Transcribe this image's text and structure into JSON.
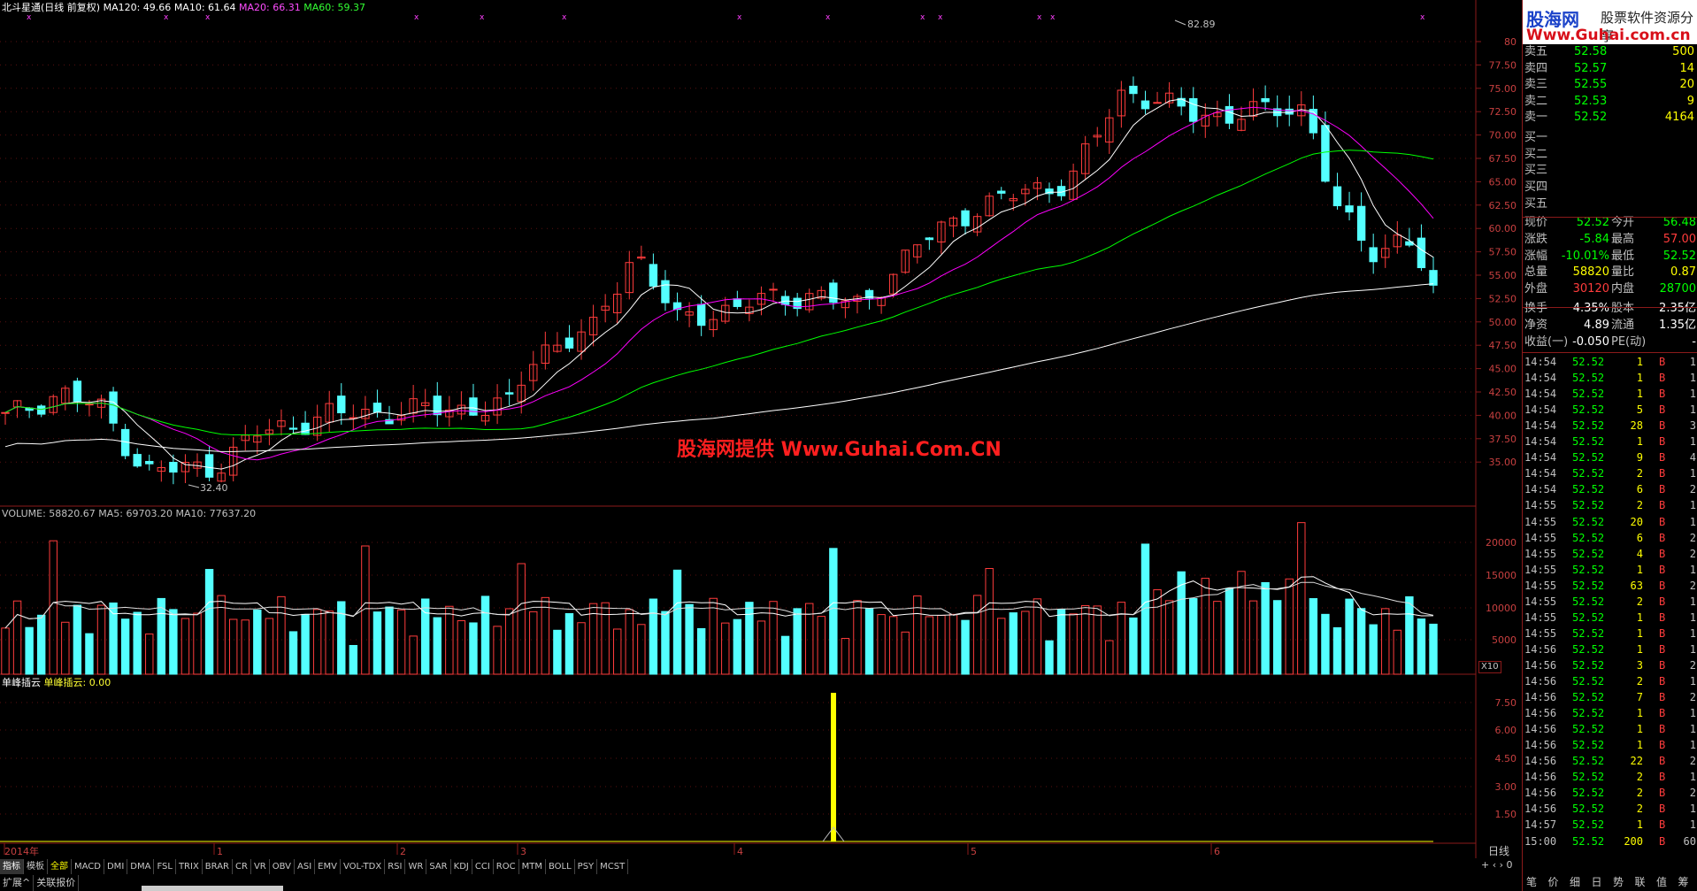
{
  "header": {
    "main_title": "北斗星通(日线 前复权)",
    "ma120": "MA120: 49.66",
    "ma10": "MA10: 61.64",
    "ma20": "MA20: 66.31",
    "ma60": "MA60: 59.37"
  },
  "price_annotations": {
    "high_label": "82.89",
    "low_label": "32.40"
  },
  "watermark": "股海网提供 Www.Guhai.Com.CN",
  "volume_header": {
    "volume": "VOLUME: 58820.67",
    "ma5": "MA5: 69703.20",
    "ma10": "MA10: 77637.20"
  },
  "indicator_header": {
    "name": "单峰插云",
    "value": "单峰插云: 0.00"
  },
  "price_axis_ticks": [
    "80",
    "77.50",
    "75.00",
    "72.50",
    "70.00",
    "67.50",
    "65.00",
    "62.50",
    "60.00",
    "57.50",
    "55.00",
    "52.50",
    "50.00",
    "47.50",
    "45.00",
    "42.50",
    "40.00",
    "37.50",
    "35.00"
  ],
  "volume_axis_ticks": [
    "20000",
    "15000",
    "10000",
    "5000"
  ],
  "volume_unit": "X10",
  "indicator_axis_ticks": [
    "7.50",
    "6.00",
    "4.50",
    "3.00",
    "1.50"
  ],
  "date_axis": [
    "2014年",
    "1",
    "2",
    "3",
    "4",
    "5",
    "6"
  ],
  "period_label": "日线",
  "tabs": [
    "指标",
    "模板",
    "全部",
    "MACD",
    "DMI",
    "DMA",
    "FSL",
    "TRIX",
    "BRAR",
    "CR",
    "VR",
    "OBV",
    "ASI",
    "EMV",
    "VOL-TDX",
    "RSI",
    "WR",
    "SAR",
    "KDJ",
    "CCI",
    "ROC",
    "MTM",
    "BOLL",
    "PSY",
    "MCST"
  ],
  "bottom_tabs": [
    "扩展^",
    "关联报价"
  ],
  "right_bottom_tabs": [
    "笔",
    "价",
    "细",
    "日",
    "势",
    "联",
    "值",
    "筹"
  ],
  "logo": {
    "l1": "股海网",
    "l2": "股票软件资源分享",
    "l3": "Www.Guhai.com.cn"
  },
  "asks": [
    {
      "label": "卖五",
      "price": "52.58",
      "vol": "500"
    },
    {
      "label": "卖四",
      "price": "52.57",
      "vol": "14"
    },
    {
      "label": "卖三",
      "price": "52.55",
      "vol": "20"
    },
    {
      "label": "卖二",
      "price": "52.53",
      "vol": "9"
    },
    {
      "label": "卖一",
      "price": "52.52",
      "vol": "4164"
    }
  ],
  "bids": [
    "买一",
    "买二",
    "买三",
    "买四",
    "买五"
  ],
  "quote_stats": [
    {
      "l1": "现价",
      "v1": "52.52",
      "l2": "今开",
      "v2": "56.48"
    },
    {
      "l1": "涨跌",
      "v1": "-5.84",
      "l2": "最高",
      "v2": "57.00"
    },
    {
      "l1": "涨幅",
      "v1": "-10.01%",
      "l2": "最低",
      "v2": "52.52"
    },
    {
      "l1": "总量",
      "v1": "58820",
      "l2": "量比",
      "v2": "0.87"
    },
    {
      "l1": "外盘",
      "v1": "30120",
      "l2": "内盘",
      "v2": "28700"
    },
    {
      "l1": "换手",
      "v1": "4.35%",
      "l2": "股本",
      "v2": "2.35亿"
    },
    {
      "l1": "净资",
      "v1": "4.89",
      "l2": "流通",
      "v2": "1.35亿"
    },
    {
      "l1": "收益(一)",
      "v1": "-0.050",
      "l2": "PE(动)",
      "v2": "-"
    }
  ],
  "ticks": [
    {
      "t": "14:54",
      "p": "52.52",
      "v": "1",
      "s": "B",
      "n": "1"
    },
    {
      "t": "14:54",
      "p": "52.52",
      "v": "1",
      "s": "B",
      "n": "1"
    },
    {
      "t": "14:54",
      "p": "52.52",
      "v": "1",
      "s": "B",
      "n": "1"
    },
    {
      "t": "14:54",
      "p": "52.52",
      "v": "5",
      "s": "B",
      "n": "1"
    },
    {
      "t": "14:54",
      "p": "52.52",
      "v": "28",
      "s": "B",
      "n": "3"
    },
    {
      "t": "14:54",
      "p": "52.52",
      "v": "1",
      "s": "B",
      "n": "1"
    },
    {
      "t": "14:54",
      "p": "52.52",
      "v": "9",
      "s": "B",
      "n": "4"
    },
    {
      "t": "14:54",
      "p": "52.52",
      "v": "2",
      "s": "B",
      "n": "1"
    },
    {
      "t": "14:54",
      "p": "52.52",
      "v": "6",
      "s": "B",
      "n": "2"
    },
    {
      "t": "14:55",
      "p": "52.52",
      "v": "2",
      "s": "B",
      "n": "1"
    },
    {
      "t": "14:55",
      "p": "52.52",
      "v": "20",
      "s": "B",
      "n": "1"
    },
    {
      "t": "14:55",
      "p": "52.52",
      "v": "6",
      "s": "B",
      "n": "2"
    },
    {
      "t": "14:55",
      "p": "52.52",
      "v": "4",
      "s": "B",
      "n": "2"
    },
    {
      "t": "14:55",
      "p": "52.52",
      "v": "1",
      "s": "B",
      "n": "1"
    },
    {
      "t": "14:55",
      "p": "52.52",
      "v": "63",
      "s": "B",
      "n": "2"
    },
    {
      "t": "14:55",
      "p": "52.52",
      "v": "2",
      "s": "B",
      "n": "1"
    },
    {
      "t": "14:55",
      "p": "52.52",
      "v": "1",
      "s": "B",
      "n": "1"
    },
    {
      "t": "14:55",
      "p": "52.52",
      "v": "1",
      "s": "B",
      "n": "1"
    },
    {
      "t": "14:56",
      "p": "52.52",
      "v": "1",
      "s": "B",
      "n": "1"
    },
    {
      "t": "14:56",
      "p": "52.52",
      "v": "3",
      "s": "B",
      "n": "2"
    },
    {
      "t": "14:56",
      "p": "52.52",
      "v": "2",
      "s": "B",
      "n": "1"
    },
    {
      "t": "14:56",
      "p": "52.52",
      "v": "7",
      "s": "B",
      "n": "2"
    },
    {
      "t": "14:56",
      "p": "52.52",
      "v": "1",
      "s": "B",
      "n": "1"
    },
    {
      "t": "14:56",
      "p": "52.52",
      "v": "1",
      "s": "B",
      "n": "1"
    },
    {
      "t": "14:56",
      "p": "52.52",
      "v": "1",
      "s": "B",
      "n": "1"
    },
    {
      "t": "14:56",
      "p": "52.52",
      "v": "22",
      "s": "B",
      "n": "2"
    },
    {
      "t": "14:56",
      "p": "52.52",
      "v": "2",
      "s": "B",
      "n": "1"
    },
    {
      "t": "14:56",
      "p": "52.52",
      "v": "2",
      "s": "B",
      "n": "2"
    },
    {
      "t": "14:56",
      "p": "52.52",
      "v": "2",
      "s": "B",
      "n": "1"
    },
    {
      "t": "14:57",
      "p": "52.52",
      "v": "1",
      "s": "B",
      "n": "1"
    },
    {
      "t": "15:00",
      "p": "52.52",
      "v": "200",
      "s": "B",
      "n": "60"
    }
  ],
  "colors": {
    "up": "#ff3c3c",
    "down": "#54ffff",
    "ma10": "#ffffff",
    "ma20": "#ff00ff",
    "ma60": "#00ff00",
    "ma120": "#ffffff",
    "grid": "#8b1a1a",
    "indicator": "#ffff00",
    "price_green": "#00ff00",
    "price_yellow": "#ffff00"
  }
}
